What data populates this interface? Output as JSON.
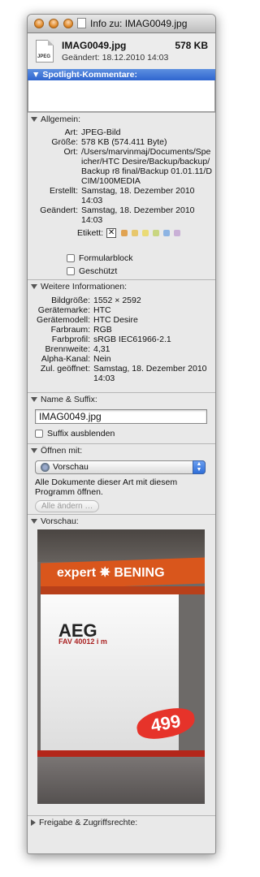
{
  "window": {
    "title": "Info zu: IMAG0049.jpg"
  },
  "header": {
    "file_name": "IMAG0049.jpg",
    "file_size": "578 KB",
    "modified": "Geändert:  18.12.2010 14:03",
    "file_type_tag": "JPEG"
  },
  "spotlight": {
    "label": "Spotlight-Kommentare:",
    "value": ""
  },
  "allgemein": {
    "label": "Allgemein:",
    "rows": [
      {
        "k": "Art:",
        "v": "JPEG-Bild"
      },
      {
        "k": "Größe:",
        "v": "578 KB (574.411 Byte)"
      },
      {
        "k": "Ort:",
        "v": "/Users/marvinmaj/Documents/Speicher/HTC Desire/Backup/backup/Backup r8 final/Backup 01.01.11/DCIM/100MEDIA"
      },
      {
        "k": "Erstellt:",
        "v": "Samstag, 18. Dezember 2010 14:03"
      },
      {
        "k": "Geändert:",
        "v": "Samstag, 18. Dezember 2010 14:03"
      }
    ],
    "etikett_label": "Etikett:",
    "label_colors": [
      "#e0a352",
      "#e7c76c",
      "#eadb76",
      "#c9d681",
      "#8db4e3",
      "#c9b0d6"
    ],
    "formularblock": "Formularblock",
    "geschuetzt": "Geschützt"
  },
  "weitere": {
    "label": "Weitere Informationen:",
    "rows": [
      {
        "k": "Bildgröße:",
        "v": "1552 × 2592"
      },
      {
        "k": "Gerätemarke:",
        "v": "HTC"
      },
      {
        "k": "Gerätemodell:",
        "v": "HTC Desire"
      },
      {
        "k": "Farbraum:",
        "v": "RGB"
      },
      {
        "k": "Farbprofil:",
        "v": "sRGB IEC61966-2.1"
      },
      {
        "k": "Brennweite:",
        "v": "4,31"
      },
      {
        "k": "Alpha-Kanal:",
        "v": "Nein"
      },
      {
        "k": "Zul. geöffnet:",
        "v": "Samstag, 18. Dezember 2010 14:03"
      }
    ]
  },
  "name_suffix": {
    "label": "Name & Suffix:",
    "value": "IMAG0049.jpg",
    "hide_suffix": "Suffix ausblenden"
  },
  "open_with": {
    "label": "Öffnen mit:",
    "app": "Vorschau",
    "note": "Alle Dokumente dieser Art mit diesem Programm öffnen.",
    "change_all": "Alle ändern …"
  },
  "preview": {
    "label": "Vorschau:",
    "banner": "expert ✵ BENING",
    "brand": "AEG",
    "model": "FAV 40012 i m",
    "price": "499"
  },
  "sharing": {
    "label": "Freigabe & Zugriffsrechte:"
  }
}
